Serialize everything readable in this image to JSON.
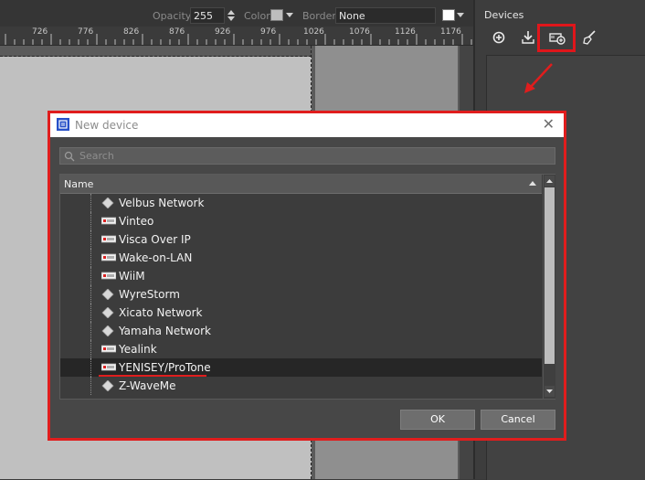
{
  "toolbar": {
    "opacity_label": "Opacity",
    "opacity_value": "255",
    "color_label": "Color",
    "border_label": "Border",
    "border_value": "None"
  },
  "ruler": {
    "labels": [
      "726",
      "776",
      "826",
      "876",
      "926",
      "976",
      "1026",
      "1076",
      "1126",
      "1176"
    ]
  },
  "devices_panel": {
    "title": "Devices",
    "buttons": [
      {
        "name": "add-icon"
      },
      {
        "name": "import-icon"
      },
      {
        "name": "add-device-icon"
      },
      {
        "name": "cleanup-icon"
      }
    ]
  },
  "dialog": {
    "title": "New device",
    "search_placeholder": "Search",
    "column_header": "Name",
    "ok_label": "OK",
    "cancel_label": "Cancel",
    "rows": [
      {
        "label": "Velbus Network",
        "icon": "diamond"
      },
      {
        "label": "Vinteo",
        "icon": "serial"
      },
      {
        "label": "Visca Over IP",
        "icon": "serial"
      },
      {
        "label": "Wake-on-LAN",
        "icon": "serial"
      },
      {
        "label": "WiiM",
        "icon": "serial"
      },
      {
        "label": "WyreStorm",
        "icon": "diamond"
      },
      {
        "label": "Xicato Network",
        "icon": "diamond"
      },
      {
        "label": "Yamaha Network",
        "icon": "diamond"
      },
      {
        "label": "Yealink",
        "icon": "serial"
      },
      {
        "label": "YENISEY/ProTone",
        "icon": "serial",
        "selected": true
      },
      {
        "label": "Z-WaveMe",
        "icon": "diamond"
      }
    ]
  },
  "colors": {
    "highlight": "#e01d1d",
    "dialog_bg": "#474747"
  }
}
